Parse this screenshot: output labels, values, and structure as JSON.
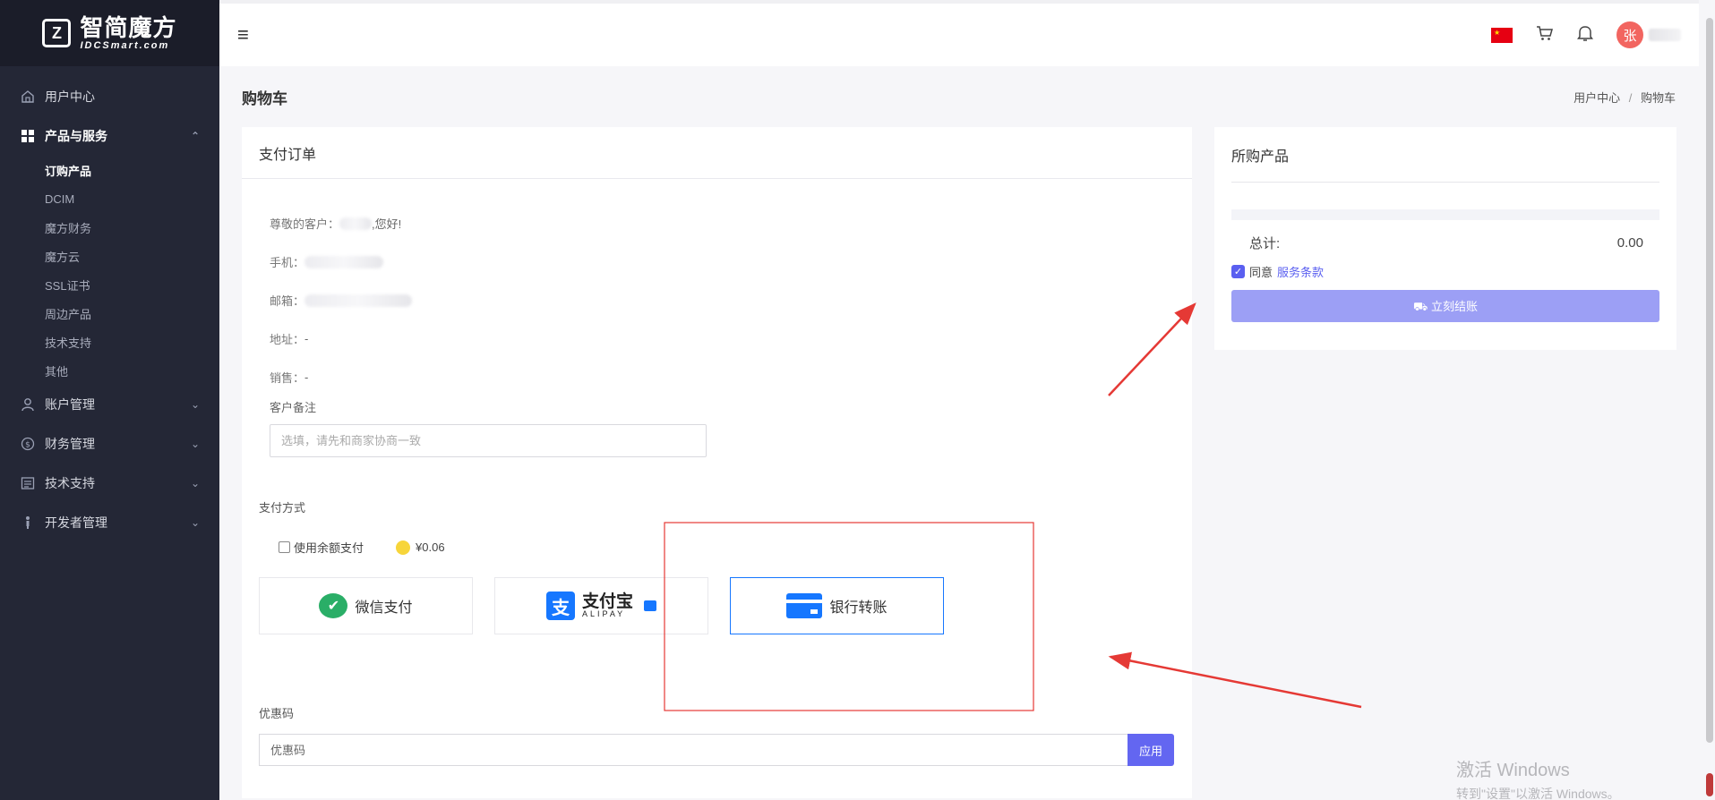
{
  "brand": {
    "name_cn": "智简魔方",
    "name_en": "IDCSmart.com",
    "mark": "Z"
  },
  "sidebar": {
    "items": [
      {
        "label": "用户中心",
        "icon": "home-icon"
      },
      {
        "label": "产品与服务",
        "icon": "grid-icon",
        "chevron": "⌃"
      },
      {
        "label": "账户管理",
        "icon": "user-icon",
        "chevron": "⌄"
      },
      {
        "label": "财务管理",
        "icon": "dollar-icon",
        "chevron": "⌄"
      },
      {
        "label": "技术支持",
        "icon": "ticket-icon",
        "chevron": "⌄"
      },
      {
        "label": "开发者管理",
        "icon": "developer-icon",
        "chevron": "⌄"
      }
    ],
    "sub_items": [
      "订购产品",
      "DCIM",
      "魔方财务",
      "魔方云",
      "SSL证书",
      "周边产品",
      "技术支持",
      "其他"
    ]
  },
  "header": {
    "avatar_initial": "张"
  },
  "page": {
    "title": "购物车",
    "breadcrumb": [
      "用户中心",
      "购物车"
    ],
    "breadcrumb_sep": "/"
  },
  "order": {
    "card_title": "支付订单",
    "greeting_prefix": "尊敬的客户：",
    "greeting_suffix": ",您好!",
    "phone_label": "手机：",
    "email_label": "邮箱：",
    "address_label": "地址：",
    "address_value": "-",
    "sales_label": "销售：",
    "sales_value": "-",
    "remark_label": "客户备注",
    "remark_placeholder": "选填，请先和商家协商一致",
    "payment_label": "支付方式",
    "balance_label": "使用余额支付",
    "balance_value": "¥0.06",
    "methods": [
      {
        "label": "微信支付",
        "icon": "wechat-pay-icon"
      },
      {
        "label_cn": "支付宝",
        "label_en": "ALIPAY",
        "icon": "alipay-icon"
      },
      {
        "label": "银行转账",
        "icon": "bank-card-icon",
        "selected": true
      }
    ],
    "coupon_label": "优惠码",
    "coupon_placeholder": "优惠码",
    "apply_label": "应用"
  },
  "summary": {
    "title": "所购产品",
    "total_label": "总计:",
    "total_value": "0.00",
    "agree_prefix": "同意",
    "terms_link": "服务条款",
    "checkout_icon": "⛟",
    "checkout_label": "立刻结账"
  },
  "watermark": {
    "line1": "激活 Windows",
    "line2": "转到\"设置\"以激活 Windows。"
  },
  "colors": {
    "accent": "#5a5ff0",
    "sidebar_bg": "#242736",
    "annotation_red": "#e53935",
    "selected_border": "#1677ff"
  }
}
